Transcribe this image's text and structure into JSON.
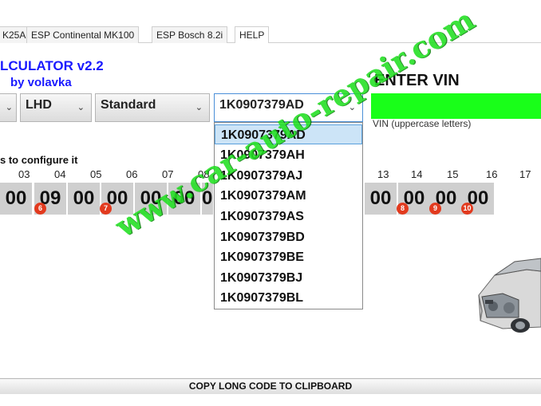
{
  "tabs": [
    "K25A",
    "ESP Continental MK100",
    "ESP Bosch 8.2i",
    "HELP"
  ],
  "title": {
    "main": "LCULATOR v2.2",
    "by": "by volavka"
  },
  "vin": {
    "heading": "ENTER VIN",
    "hint": "VIN (uppercase letters)",
    "box_color": "#19ff19"
  },
  "selects": {
    "first": "",
    "drive_side": "LHD",
    "variant": "Standard",
    "part_number": "1K0907379AD"
  },
  "dropdown": {
    "items": [
      "1K0907379AD",
      "1K0907379AH",
      "1K0907379AJ",
      "1K0907379AM",
      "1K0907379AS",
      "1K0907379BD",
      "1K0907379BE",
      "1K0907379BJ",
      "1K0907379BL"
    ],
    "selected_index": 0
  },
  "configure_text": "s to configure it",
  "bytes": {
    "numbers": [
      "03",
      "04",
      "05",
      "06",
      "07",
      "08",
      "13",
      "14",
      "15",
      "16",
      "17"
    ],
    "values": [
      "00",
      "09",
      "00",
      "00",
      "00",
      "00",
      "0",
      "00",
      "00",
      "00",
      "00"
    ],
    "badges": [
      "6",
      "7",
      "8",
      "9",
      "10"
    ]
  },
  "copy_button": "COPY LONG CODE TO CLIPBOARD",
  "watermark": "www.car-auto-repair.com",
  "colors": {
    "title_blue": "#1a1aff",
    "vin_green": "#19ff19",
    "badge_red": "#e23a1e",
    "watermark_green": "#21e021"
  },
  "icons": {
    "dropdown_arrow": "chevron-down-icon",
    "car": "car-image"
  }
}
